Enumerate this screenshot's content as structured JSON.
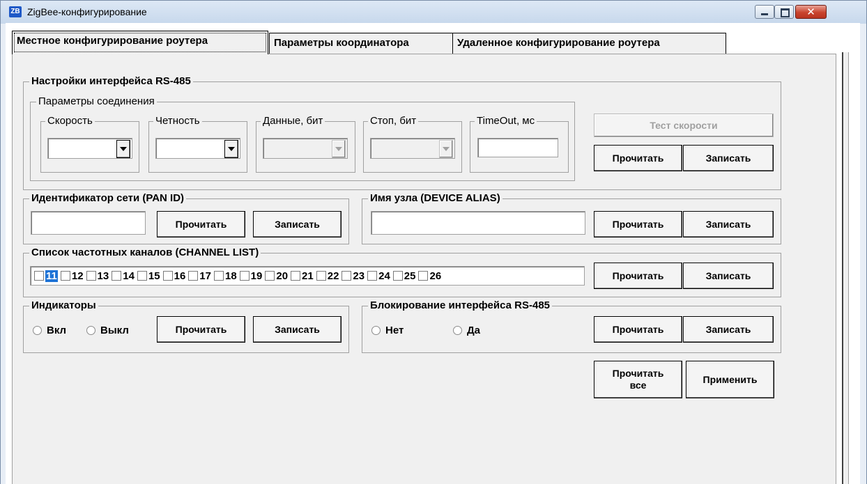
{
  "window": {
    "title": "ZigBee-конфигурирование",
    "icon": "zb-app-icon",
    "controls": {
      "minimize": "minimize-icon",
      "maximize": "maximize-icon",
      "close_label": "✕"
    }
  },
  "tabs": [
    {
      "label": "Местное конфигурирование роутера",
      "active": true
    },
    {
      "label": "Параметры координатора",
      "active": false
    },
    {
      "label": "Удаленное конфигурирование роутера",
      "active": false
    }
  ],
  "rs485": {
    "title": "Настройки интерфейса RS-485",
    "connection_title": "Параметры соединения",
    "speed": {
      "label": "Скорость",
      "value": ""
    },
    "parity": {
      "label": "Четность",
      "value": ""
    },
    "data_bits": {
      "label": "Данные, бит",
      "value": ""
    },
    "stop_bits": {
      "label": "Стоп, бит",
      "value": ""
    },
    "timeout": {
      "label": "TimeOut, мс",
      "value": ""
    },
    "test_speed": "Тест скорости",
    "read": "Прочитать",
    "write": "Записать"
  },
  "pan_id": {
    "title": "Идентификатор сети (PAN ID)",
    "value": "",
    "read": "Прочитать",
    "write": "Записать"
  },
  "alias": {
    "title": "Имя узла (DEVICE ALIAS)",
    "value": "",
    "read": "Прочитать",
    "write": "Записать"
  },
  "channels": {
    "title": "Список частотных каналов (CHANNEL LIST)",
    "items": [
      "11",
      "12",
      "13",
      "14",
      "15",
      "16",
      "17",
      "18",
      "19",
      "20",
      "21",
      "22",
      "23",
      "24",
      "25",
      "26"
    ],
    "selected": "11",
    "read": "Прочитать",
    "write": "Записать"
  },
  "indicators": {
    "title": "Индикаторы",
    "on": "Вкл",
    "off": "Выкл",
    "read": "Прочитать",
    "write": "Записать"
  },
  "lock": {
    "title": "Блокирование интерфейса RS-485",
    "no": "Нет",
    "yes": "Да",
    "read": "Прочитать",
    "write": "Записать"
  },
  "footer": {
    "read_all_line1": "Прочитать",
    "read_all_line2": "все",
    "apply": "Применить"
  },
  "colors": {
    "accent": "#1e73d6",
    "tab_bg": "#f0f0f0",
    "close": "#c9442e"
  }
}
